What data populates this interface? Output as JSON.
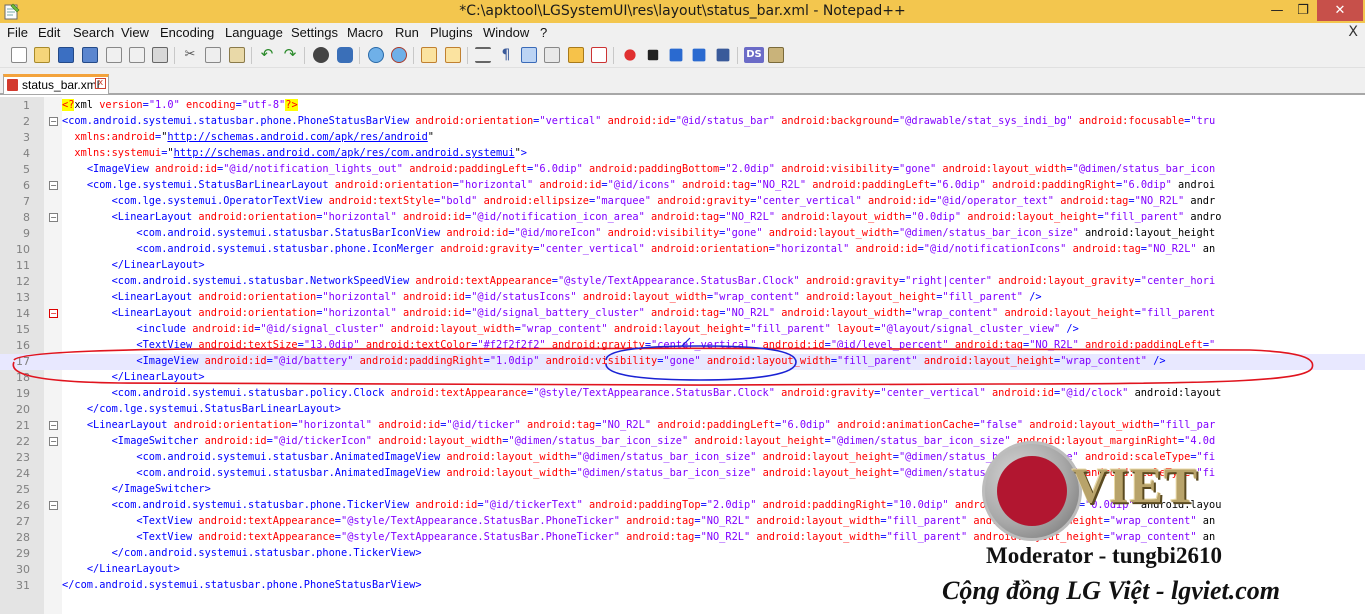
{
  "window": {
    "title": "*C:\\apktool\\LGSystemUI\\res\\layout\\status_bar.xml - Notepad++",
    "minimize_glyph": "—",
    "maximize_glyph": "❐",
    "close_glyph": "✕"
  },
  "menu": {
    "items": [
      "File",
      "Edit",
      "Search",
      "View",
      "Encoding",
      "Language",
      "Settings",
      "Macro",
      "Run",
      "Plugins",
      "Window",
      "?"
    ],
    "close_glyph": "X"
  },
  "toolbar": {
    "icons": [
      "new-file-icon",
      "open-file-icon",
      "save-icon",
      "save-all-icon",
      "close-icon",
      "close-all-icon",
      "print-icon",
      "cut-icon",
      "copy-icon",
      "paste-icon",
      "undo-icon",
      "redo-icon",
      "find-icon",
      "replace-icon",
      "zoom-in-icon",
      "zoom-out-icon",
      "sync-v-icon",
      "sync-h-icon",
      "word-wrap-icon",
      "all-chars-icon",
      "indent-guide-icon",
      "udl-icon",
      "doc-map-icon",
      "function-list-icon",
      "record-macro-icon",
      "stop-record-icon",
      "play-macro-icon",
      "play-multi-icon",
      "save-macro-icon",
      "ds-icon",
      "plugin-icon"
    ],
    "ds_label": "DS"
  },
  "tab": {
    "label": "status_bar.xml",
    "close_glyph": "x"
  },
  "editor": {
    "current_line": 17,
    "lines": [
      {
        "n": "1",
        "fold": "",
        "code": "<?xml version=\"1.0\" encoding=\"utf-8\"?>"
      },
      {
        "n": "2",
        "fold": "box",
        "code": "<com.android.systemui.statusbar.phone.PhoneStatusBarView android:orientation=\"vertical\" android:id=\"@id/status_bar\" android:background=\"@drawable/stat_sys_indi_bg\" android:focusable=\"tru"
      },
      {
        "n": "3",
        "fold": "",
        "code": "  xmlns:android=\"http://schemas.android.com/apk/res/android\""
      },
      {
        "n": "4",
        "fold": "",
        "code": "  xmlns:systemui=\"http://schemas.android.com/apk/res/com.android.systemui\">"
      },
      {
        "n": "5",
        "fold": "",
        "code": "    <ImageView android:id=\"@id/notification_lights_out\" android:paddingLeft=\"6.0dip\" android:paddingBottom=\"2.0dip\" android:visibility=\"gone\" android:layout_width=\"@dimen/status_bar_icon"
      },
      {
        "n": "6",
        "fold": "box",
        "code": "    <com.lge.systemui.StatusBarLinearLayout android:orientation=\"horizontal\" android:id=\"@id/icons\" android:tag=\"NO_R2L\" android:paddingLeft=\"6.0dip\" android:paddingRight=\"6.0dip\" androi"
      },
      {
        "n": "7",
        "fold": "",
        "code": "        <com.lge.systemui.OperatorTextView android:textStyle=\"bold\" android:ellipsize=\"marquee\" android:gravity=\"center_vertical\" android:id=\"@id/operator_text\" android:tag=\"NO_R2L\" andr"
      },
      {
        "n": "8",
        "fold": "box",
        "code": "        <LinearLayout android:orientation=\"horizontal\" android:id=\"@id/notification_icon_area\" android:tag=\"NO_R2L\" android:layout_width=\"0.0dip\" android:layout_height=\"fill_parent\" andro"
      },
      {
        "n": "9",
        "fold": "",
        "code": "            <com.android.systemui.statusbar.StatusBarIconView android:id=\"@id/moreIcon\" android:visibility=\"gone\" android:layout_width=\"@dimen/status_bar_icon_size\" android:layout_height"
      },
      {
        "n": "10",
        "fold": "",
        "code": "            <com.android.systemui.statusbar.phone.IconMerger android:gravity=\"center_vertical\" android:orientation=\"horizontal\" android:id=\"@id/notificationIcons\" android:tag=\"NO_R2L\" an"
      },
      {
        "n": "11",
        "fold": "",
        "code": "        </LinearLayout>"
      },
      {
        "n": "12",
        "fold": "",
        "code": "        <com.android.systemui.statusbar.NetworkSpeedView android:textAppearance=\"@style/TextAppearance.StatusBar.Clock\" android:gravity=\"right|center\" android:layout_gravity=\"center_hori"
      },
      {
        "n": "13",
        "fold": "",
        "code": "        <LinearLayout android:orientation=\"horizontal\" android:id=\"@id/statusIcons\" android:layout_width=\"wrap_content\" android:layout_height=\"fill_parent\" />"
      },
      {
        "n": "14",
        "fold": "boxred",
        "code": "        <LinearLayout android:orientation=\"horizontal\" android:id=\"@id/signal_battery_cluster\" android:tag=\"NO_R2L\" android:layout_width=\"wrap_content\" android:layout_height=\"fill_parent"
      },
      {
        "n": "15",
        "fold": "",
        "code": "            <include android:id=\"@id/signal_cluster\" android:layout_width=\"wrap_content\" android:layout_height=\"fill_parent\" layout=\"@layout/signal_cluster_view\" />"
      },
      {
        "n": "16",
        "fold": "",
        "code": "            <TextView android:textSize=\"13.0dip\" android:textColor=\"#f2f2f2f2\" android:gravity=\"center_vertical\" android:id=\"@id/level_percent\" android:tag=\"NO_R2L\" android:paddingLeft=\""
      },
      {
        "n": "17",
        "fold": "",
        "code": "            <ImageView android:id=\"@id/battery\" android:paddingRight=\"1.0dip\" android:visibility=\"gone\" android:layout_width=\"fill_parent\" android:layout_height=\"wrap_content\" />"
      },
      {
        "n": "18",
        "fold": "",
        "code": "        </LinearLayout>"
      },
      {
        "n": "19",
        "fold": "",
        "code": "        <com.android.systemui.statusbar.policy.Clock android:textAppearance=\"@style/TextAppearance.StatusBar.Clock\" android:gravity=\"center_vertical\" android:id=\"@id/clock\" android:layout"
      },
      {
        "n": "20",
        "fold": "",
        "code": "    </com.lge.systemui.StatusBarLinearLayout>"
      },
      {
        "n": "21",
        "fold": "box",
        "code": "    <LinearLayout android:orientation=\"horizontal\" android:id=\"@id/ticker\" android:tag=\"NO_R2L\" android:paddingLeft=\"6.0dip\" android:animationCache=\"false\" android:layout_width=\"fill_par"
      },
      {
        "n": "22",
        "fold": "box",
        "code": "        <ImageSwitcher android:id=\"@id/tickerIcon\" android:layout_width=\"@dimen/status_bar_icon_size\" android:layout_height=\"@dimen/status_bar_icon_size\" android:layout_marginRight=\"4.0d"
      },
      {
        "n": "23",
        "fold": "",
        "code": "            <com.android.systemui.statusbar.AnimatedImageView android:layout_width=\"@dimen/status_bar_icon_size\" android:layout_height=\"@dimen/status_bar_icon_size\" android:scaleType=\"fi"
      },
      {
        "n": "24",
        "fold": "",
        "code": "            <com.android.systemui.statusbar.AnimatedImageView android:layout_width=\"@dimen/status_bar_icon_size\" android:layout_height=\"@dimen/status_bar_icon_size\" android:scaleType=\"fi"
      },
      {
        "n": "25",
        "fold": "",
        "code": "        </ImageSwitcher>"
      },
      {
        "n": "26",
        "fold": "box",
        "code": "        <com.android.systemui.statusbar.phone.TickerView android:id=\"@id/tickerText\" android:paddingTop=\"2.0dip\" android:paddingRight=\"10.0dip\" android:layout_width=\"0.0dip\" android:layou"
      },
      {
        "n": "27",
        "fold": "",
        "code": "            <TextView android:textAppearance=\"@style/TextAppearance.StatusBar.PhoneTicker\" android:tag=\"NO_R2L\" android:layout_width=\"fill_parent\" android:layout_height=\"wrap_content\" an"
      },
      {
        "n": "28",
        "fold": "",
        "code": "            <TextView android:textAppearance=\"@style/TextAppearance.StatusBar.PhoneTicker\" android:tag=\"NO_R2L\" android:layout_width=\"fill_parent\" android:layout_height=\"wrap_content\" an"
      },
      {
        "n": "29",
        "fold": "",
        "code": "        </com.android.systemui.statusbar.phone.TickerView>"
      },
      {
        "n": "30",
        "fold": "",
        "code": "    </LinearLayout>"
      },
      {
        "n": "31",
        "fold": "",
        "code": "</com.android.systemui.statusbar.phone.PhoneStatusBarView>"
      }
    ]
  },
  "watermark": {
    "logo_text": "VIET",
    "moderator": "Moderator - tungbi2610",
    "community": "Cộng đồng LG Việt - lgviet.com"
  },
  "colors": {
    "title_bar": "#f3c64e",
    "tag": "#0000ff",
    "attribute": "#ff0000",
    "value": "#8000ff",
    "annotation_red": "#e0141e",
    "annotation_blue": "#1a22d4",
    "lg_red": "#b21630"
  }
}
